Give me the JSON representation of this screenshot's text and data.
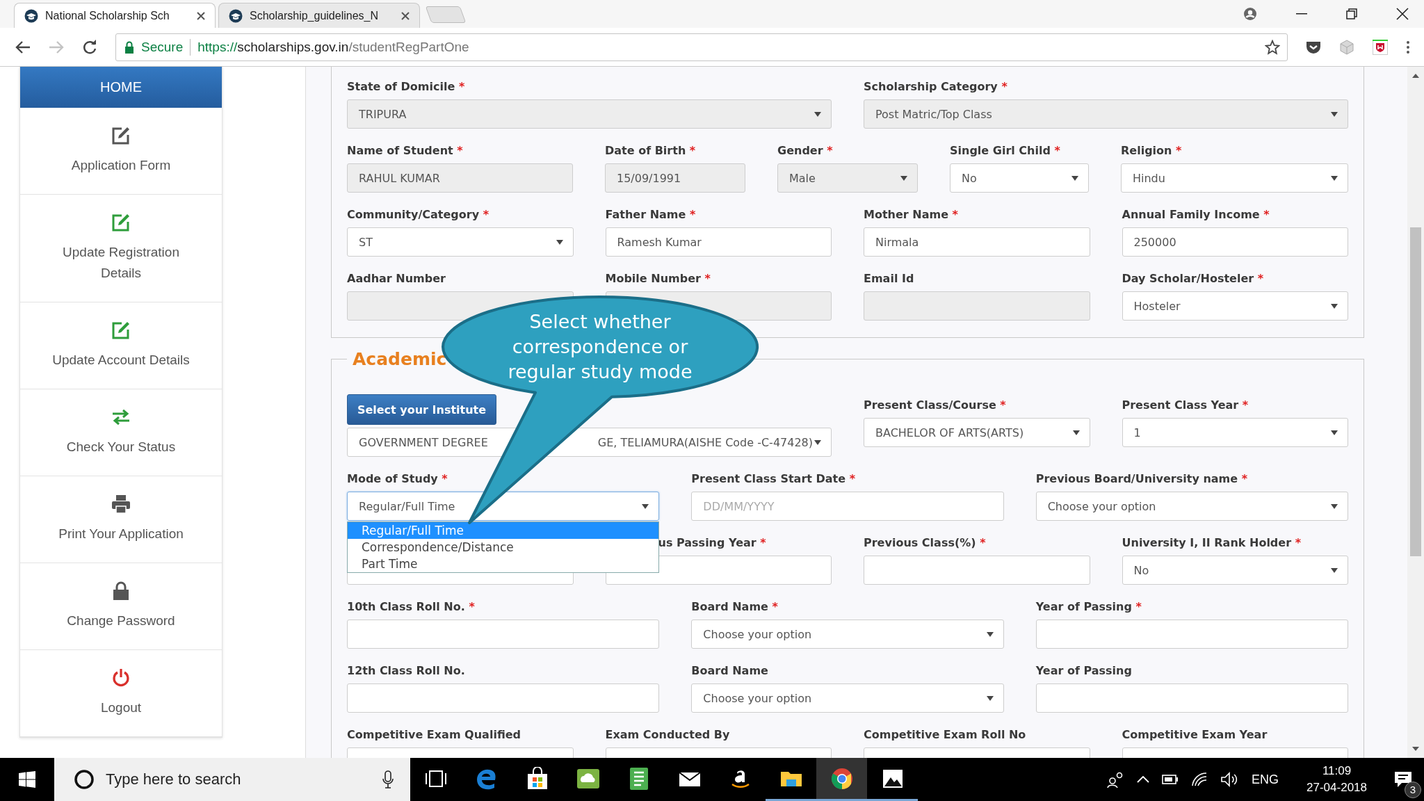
{
  "browser": {
    "tabs": [
      {
        "title": "National Scholarship Sch",
        "selected": true
      },
      {
        "title": "Scholarship_guidelines_N",
        "selected": false
      }
    ],
    "security_label": "Secure",
    "url": {
      "scheme": "https://",
      "host": "scholarships.gov.in",
      "path": "/studentRegPartOne"
    }
  },
  "sidebar": {
    "header": "HOME",
    "items": [
      {
        "label": "Application Form",
        "kind": "edit",
        "color": "#555555"
      },
      {
        "label": "Update Registration Details",
        "kind": "edit",
        "color": "#2e9d3b"
      },
      {
        "label": "Update Account Details",
        "kind": "edit",
        "color": "#2e9d3b"
      },
      {
        "label": "Check Your Status",
        "kind": "swap",
        "color": "#2e9d3b"
      },
      {
        "label": "Print Your Application",
        "kind": "printer",
        "color": "#555555"
      },
      {
        "label": "Change Password",
        "kind": "lock",
        "color": "#555555"
      },
      {
        "label": "Logout",
        "kind": "power",
        "color": "#d9302c"
      }
    ]
  },
  "personal_section": {
    "rows": [
      {
        "fields": [
          {
            "label": "State of Domicile",
            "required_mark": "*",
            "kind": "select",
            "value": "TRIPURA",
            "disabled": true
          },
          {
            "label": "Scholarship Category",
            "required_mark": "*",
            "kind": "select",
            "value": "Post Matric/Top Class",
            "disabled": true
          }
        ]
      },
      {
        "fields": [
          {
            "label": "Name of Student",
            "required_mark": "*",
            "kind": "input",
            "value": "RAHUL KUMAR",
            "disabled": true
          },
          {
            "label": "Date of Birth",
            "required_mark": "*",
            "kind": "input",
            "value": "15/09/1991",
            "disabled": true
          },
          {
            "label": "Gender",
            "required_mark": "*",
            "kind": "select",
            "value": "Male",
            "disabled": true
          },
          {
            "label": "Single Girl Child",
            "required_mark": "*",
            "kind": "select",
            "value": "No",
            "disabled": false
          },
          {
            "label": "Religion",
            "required_mark": "*",
            "kind": "select",
            "value": "Hindu",
            "disabled": false
          }
        ]
      },
      {
        "fields": [
          {
            "label": "Community/Category",
            "required_mark": "*",
            "kind": "select",
            "value": "ST",
            "disabled": false
          },
          {
            "label": "Father Name",
            "required_mark": "*",
            "kind": "input",
            "value": "Ramesh Kumar",
            "disabled": false
          },
          {
            "label": "Mother Name",
            "required_mark": "*",
            "kind": "input",
            "value": "Nirmala",
            "disabled": false
          },
          {
            "label": "Annual Family Income",
            "required_mark": "*",
            "kind": "input",
            "value": "250000",
            "disabled": false
          }
        ]
      },
      {
        "fields": [
          {
            "label": "Aadhar Number",
            "kind": "input",
            "disabled": true
          },
          {
            "label": "Mobile Number",
            "required_mark": "*",
            "kind": "input",
            "disabled": true
          },
          {
            "label": "Email Id",
            "kind": "input",
            "disabled": true
          },
          {
            "label": "Day Scholar/Hosteler",
            "required_mark": "*",
            "kind": "select",
            "value": "Hosteler",
            "disabled": false
          }
        ]
      }
    ]
  },
  "academic_section": {
    "legend": "Academic",
    "rows": [
      {
        "fields": [
          {
            "kind": "institute",
            "button": "Select your Institute",
            "value_parts": [
              "GOVERNMENT DEGREE",
              "GE, TELIAMURA(AISHE Code -C-47428)"
            ],
            "disabled": false
          },
          {
            "label": "Present Class/Course",
            "required_mark": "*",
            "kind": "select",
            "value": "BACHELOR OF ARTS(ARTS)",
            "disabled": false
          },
          {
            "label": "Present Class Year",
            "required_mark": "*",
            "kind": "select",
            "value": "1",
            "disabled": false
          }
        ]
      },
      {
        "fields": [
          {
            "label": "Mode of Study",
            "required_mark": "*",
            "kind": "select",
            "value": "Regular/Full Time",
            "disabled": false,
            "open": true,
            "options": [
              {
                "label": "Regular/Full Time",
                "selected": true
              },
              {
                "label": "Correspondence/Distance",
                "selected": false
              },
              {
                "label": "Part Time",
                "selected": false
              }
            ]
          },
          {
            "label": "Present Class Start Date",
            "required_mark": "*",
            "kind": "input",
            "placeholder": "DD/MM/YYYY",
            "disabled": false
          },
          {
            "label": "Previous Board/University name",
            "required_mark": "*",
            "kind": "select",
            "value": "Choose your option",
            "disabled": false
          }
        ]
      },
      {
        "fields": [
          {
            "kind": "input",
            "disabled": false
          },
          {
            "label": "us Passing Year",
            "required_mark": "*",
            "label_clipped": true,
            "kind": "input",
            "disabled": false
          },
          {
            "label": "Previous Class(%)",
            "required_mark": "*",
            "kind": "input",
            "disabled": false
          },
          {
            "label": "University I, II Rank Holder",
            "required_mark": "*",
            "kind": "select",
            "value": "No",
            "disabled": false
          }
        ]
      },
      {
        "fields": [
          {
            "label": "10th Class Roll No.",
            "required_mark": "*",
            "kind": "input",
            "disabled": false
          },
          {
            "label": "Board Name",
            "required_mark": "*",
            "kind": "select",
            "value": "Choose your option",
            "disabled": false
          },
          {
            "label": "Year of Passing",
            "required_mark": "*",
            "kind": "input",
            "disabled": false
          }
        ]
      },
      {
        "fields": [
          {
            "label": "12th Class Roll No.",
            "kind": "input",
            "disabled": false
          },
          {
            "label": "Board Name",
            "kind": "select",
            "value": "Choose your option",
            "disabled": false
          },
          {
            "label": "Year of Passing",
            "kind": "input",
            "disabled": false
          }
        ]
      },
      {
        "fields": [
          {
            "label": "Competitive Exam Qualified",
            "kind": "input",
            "disabled": false
          },
          {
            "label": "Exam Conducted By",
            "kind": "input",
            "disabled": false
          },
          {
            "label": "Competitive Exam Roll No",
            "kind": "input",
            "disabled": false
          },
          {
            "label": "Competitive Exam Year",
            "kind": "input",
            "disabled": false
          }
        ]
      }
    ]
  },
  "callout": {
    "text": "Select whether correspondence or regular study mode"
  },
  "taskbar": {
    "search_placeholder": "Type here to search",
    "apps": [
      {
        "kind": "task-view",
        "running": false,
        "selected": false
      },
      {
        "kind": "edge",
        "running": false,
        "selected": false
      },
      {
        "kind": "store",
        "running": false,
        "selected": false
      },
      {
        "kind": "cloud",
        "running": false,
        "selected": false
      },
      {
        "kind": "notes",
        "running": false,
        "selected": false
      },
      {
        "kind": "mail",
        "running": false,
        "selected": false
      },
      {
        "kind": "amazon",
        "running": false,
        "selected": false
      },
      {
        "kind": "explorer",
        "running": true,
        "selected": false
      },
      {
        "kind": "chrome",
        "running": true,
        "selected": true
      },
      {
        "kind": "photos",
        "running": true,
        "selected": false
      }
    ],
    "language": "ENG",
    "time": "11:09",
    "date": "27-04-2018",
    "notification_count": "3"
  }
}
